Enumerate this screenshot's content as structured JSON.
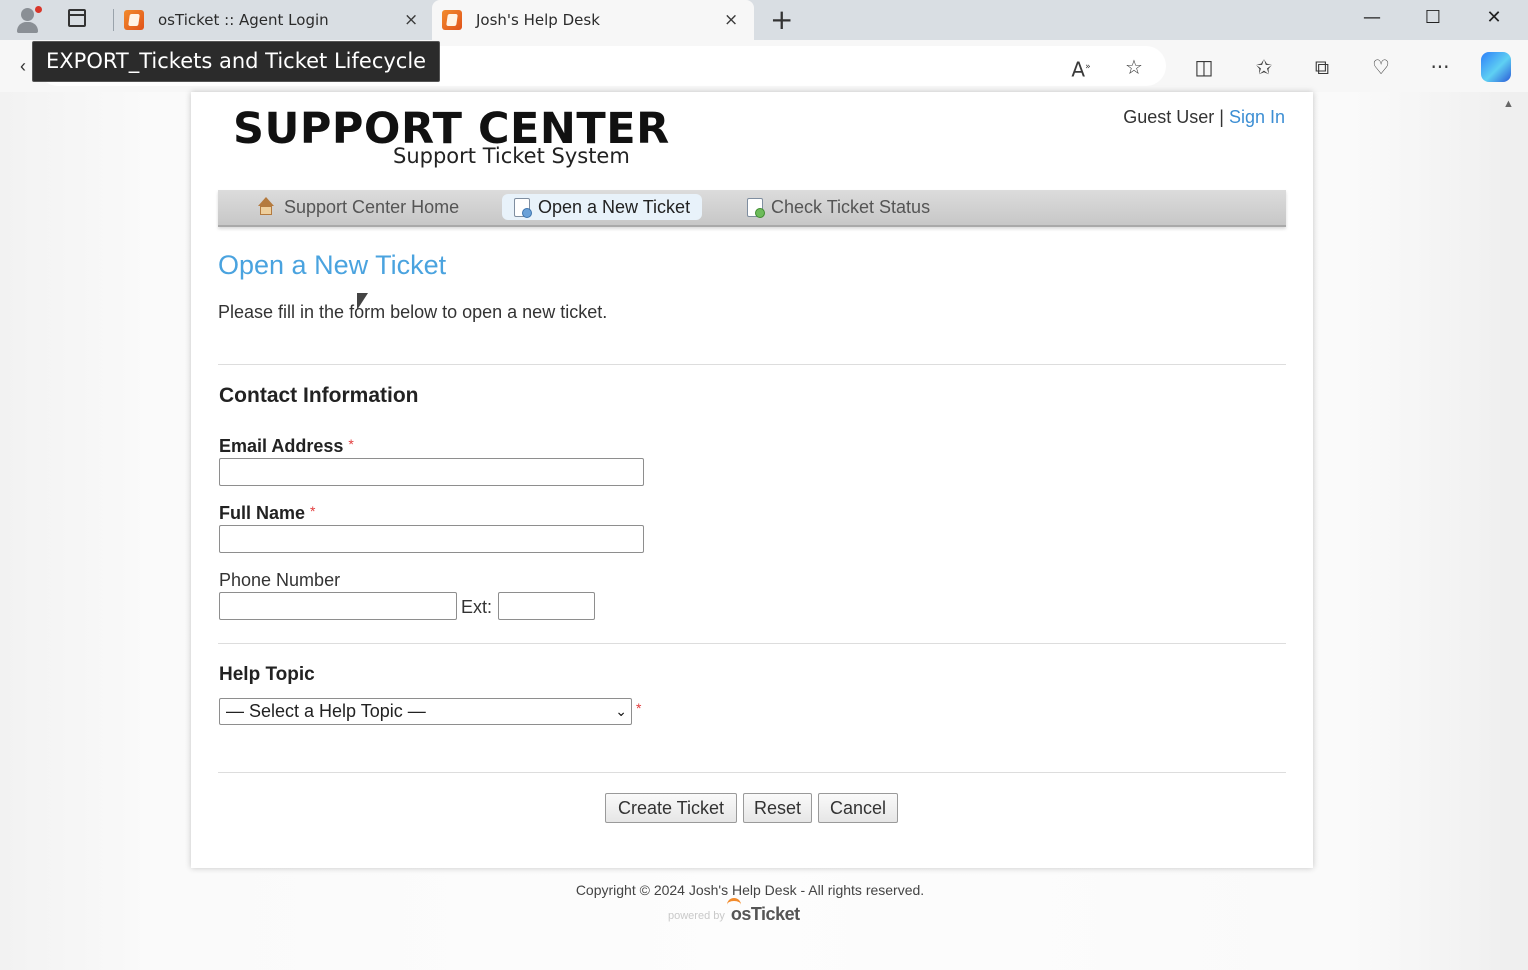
{
  "browser": {
    "tabs": [
      {
        "label": "osTicket :: Agent Login",
        "close": "×"
      },
      {
        "label": "Josh's Help Desk",
        "close": "×"
      }
    ],
    "new_tab": "+",
    "tooltip": "EXPORT_Tickets and Ticket Lifecycle",
    "window_controls": {
      "minimize": "—",
      "maximize": "☐",
      "close": "✕"
    },
    "toolbar_icons": [
      "read-aloud-icon",
      "favorite-star-icon",
      "split-screen-icon",
      "favorites-icon",
      "collections-icon",
      "browser-essentials-icon",
      "more-icon",
      "copilot-icon"
    ]
  },
  "header": {
    "logo_title": "SUPPORT CENTER",
    "logo_subtitle": "Support Ticket System",
    "user_label": "Guest User",
    "separator": "|",
    "sign_in": "Sign In"
  },
  "nav": {
    "items": [
      {
        "label": "Support Center Home",
        "icon": "home-icon",
        "active": false
      },
      {
        "label": "Open a New Ticket",
        "icon": "new-ticket-icon",
        "active": true
      },
      {
        "label": "Check Ticket Status",
        "icon": "ticket-status-icon",
        "active": false
      }
    ]
  },
  "main": {
    "title": "Open a New Ticket",
    "intro": "Please fill in the form below to open a new ticket.",
    "contact_heading": "Contact Information",
    "email_label": "Email Address",
    "full_name_label": "Full Name",
    "phone_label": "Phone Number",
    "ext_label": "Ext:",
    "required_mark": "*",
    "email_value": "",
    "full_name_value": "",
    "phone_value": "",
    "ext_value": "",
    "help_topic_heading": "Help Topic",
    "help_topic_selected": "— Select a Help Topic —"
  },
  "buttons": {
    "create": "Create Ticket",
    "reset": "Reset",
    "cancel": "Cancel"
  },
  "footer": {
    "copyright": "Copyright © 2024 Josh's Help Desk - All rights reserved.",
    "powered_by": "powered by",
    "powered_logo": "osTicket"
  },
  "colors": {
    "accent_link": "#3c8ed3",
    "title_blue": "#4aa3df",
    "required_red": "#e23b3b"
  }
}
